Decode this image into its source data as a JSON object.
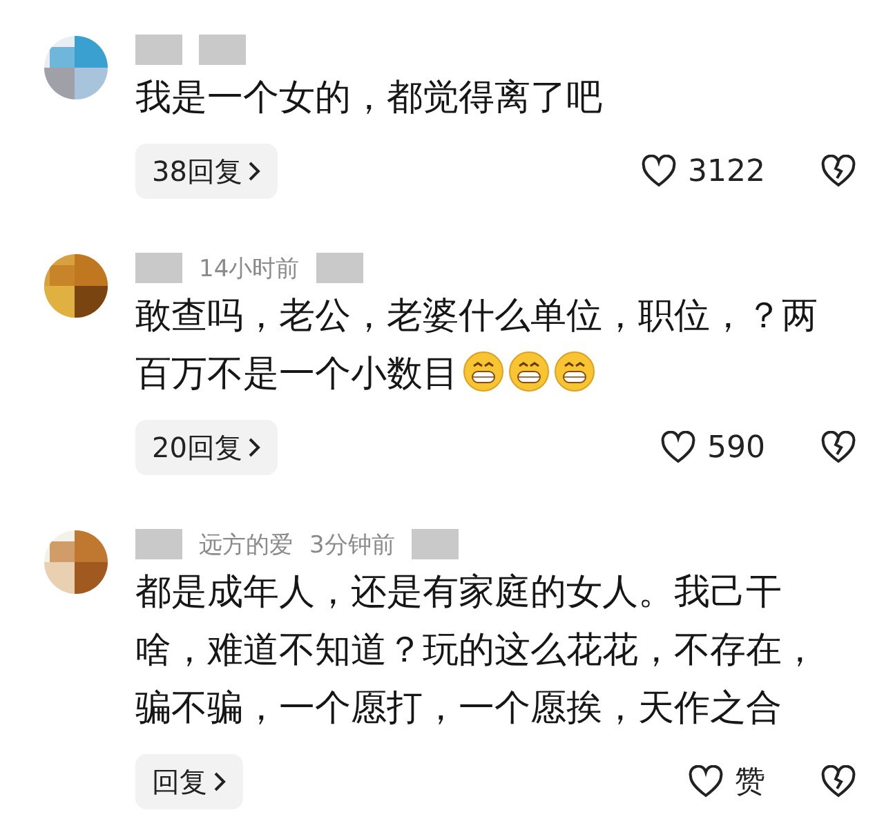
{
  "comments": [
    {
      "text": "我是一个女的，都觉得离了吧",
      "replies": "38回复",
      "likes": "3122"
    },
    {
      "meta": {
        "time": "14小时前"
      },
      "text": "敢查吗，老公，老婆什么单位，职位，？两百万不是一个小数目",
      "emojis": [
        {
          "kind": "grin"
        },
        {
          "kind": "grin"
        },
        {
          "kind": "grin"
        }
      ],
      "replies": "20回复",
      "likes": "590"
    },
    {
      "meta": {
        "author": "远方的爱",
        "time": "3分钟前"
      },
      "text": "都是成年人，还是有家庭的女人。我己干啥，难道不知道？玩的这么花花，不存在，骗不骗，一个愿打，一个愿挨，天作之合",
      "replies": "回复",
      "likes": "赞"
    }
  ]
}
